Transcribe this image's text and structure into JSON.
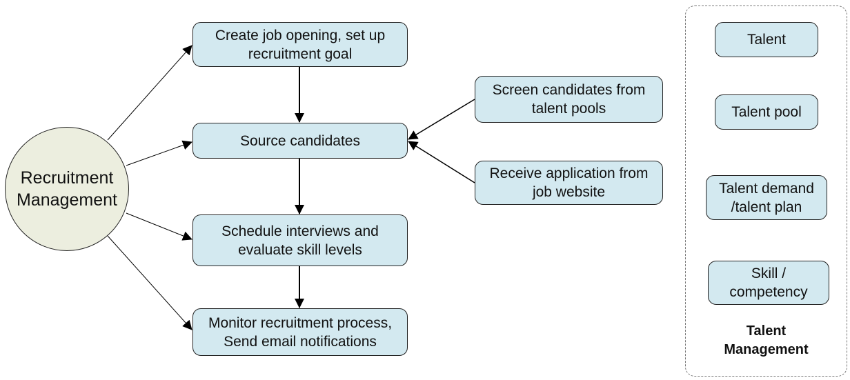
{
  "diagram": {
    "hub": {
      "label": "Recruitment\nManagement"
    },
    "process_steps": [
      {
        "id": "create",
        "label": "Create job opening, set up\nrecruitment goal"
      },
      {
        "id": "source",
        "label": "Source candidates"
      },
      {
        "id": "schedule",
        "label": "Schedule interviews and\nevaluate skill levels"
      },
      {
        "id": "monitor",
        "label": "Monitor recruitment process,\nSend email notifications"
      }
    ],
    "sources": [
      {
        "id": "screen",
        "label": "Screen candidates from\ntalent pools"
      },
      {
        "id": "receive",
        "label": "Receive application from\njob website"
      }
    ],
    "talent_group": {
      "title": "Talent\nManagement",
      "items": [
        {
          "id": "talent",
          "label": "Talent"
        },
        {
          "id": "pool",
          "label": "Talent pool"
        },
        {
          "id": "demand",
          "label": "Talent demand\n/talent plan"
        },
        {
          "id": "skill",
          "label": "Skill /\ncompetency"
        }
      ]
    },
    "edges": [
      {
        "from": "hub",
        "to": "create"
      },
      {
        "from": "hub",
        "to": "source"
      },
      {
        "from": "hub",
        "to": "schedule"
      },
      {
        "from": "hub",
        "to": "monitor"
      },
      {
        "from": "create",
        "to": "source"
      },
      {
        "from": "source",
        "to": "schedule"
      },
      {
        "from": "schedule",
        "to": "monitor"
      },
      {
        "from": "screen",
        "to": "source"
      },
      {
        "from": "receive",
        "to": "source"
      }
    ],
    "colors": {
      "box_fill": "#d3e9f0",
      "hub_fill": "#eceedf",
      "stroke": "#222222"
    }
  }
}
